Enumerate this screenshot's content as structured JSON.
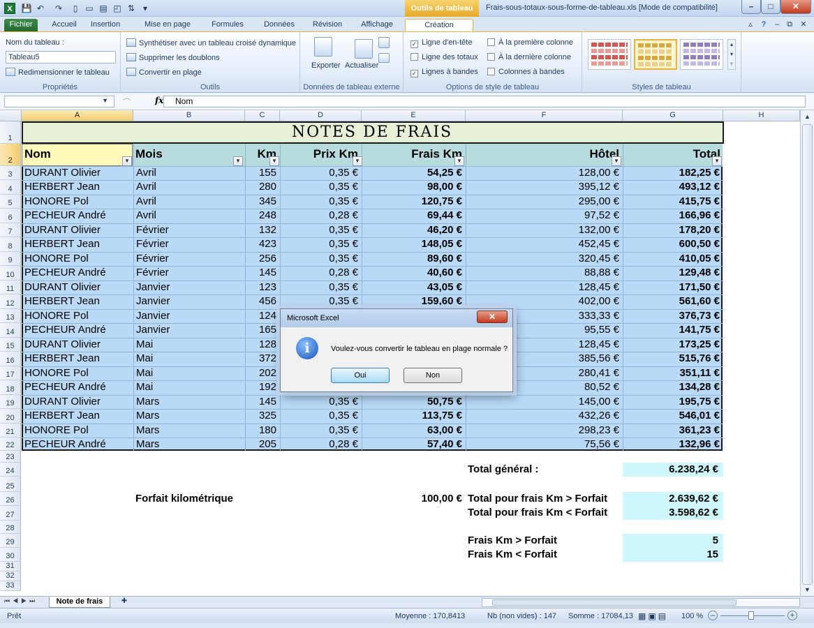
{
  "window": {
    "title": "Frais-sous-totaux-sous-forme-de-tableau.xls  [Mode de compatibilité]",
    "contextual_tab": "Outils de tableau",
    "min": "–",
    "max": "□",
    "close": "✕"
  },
  "tabs": [
    "Fichier",
    "Accueil",
    "Insertion",
    "Mise en page",
    "Formules",
    "Données",
    "Révision",
    "Affichage",
    "Création"
  ],
  "ribbon": {
    "proprietes": {
      "name_label": "Nom du tableau :",
      "name_value": "Tableau5",
      "resize": "Redimensionner le tableau",
      "group": "Propriétés"
    },
    "outils": {
      "pivot": "Synthétiser avec un tableau croisé dynamique",
      "dedupe": "Supprimer les doublons",
      "convert": "Convertir en plage",
      "group": "Outils"
    },
    "externe": {
      "export": "Exporter",
      "refresh": "Actualiser",
      "group": "Données de tableau externe"
    },
    "options": {
      "header_row": "Ligne d'en-tête",
      "total_row": "Ligne des totaux",
      "banded_rows": "Lignes à bandes",
      "first_col": "À la première colonne",
      "last_col": "À la dernière colonne",
      "banded_cols": "Colonnes à bandes",
      "group": "Options de style de tableau",
      "checks": {
        "header_row": "✓",
        "total_row": "",
        "banded_rows": "✓",
        "first_col": "",
        "last_col": "",
        "banded_cols": ""
      }
    },
    "styles": {
      "group": "Styles de tableau",
      "colors": [
        "#d9534f",
        "#e7b84a",
        "#8e7cc3"
      ]
    }
  },
  "formula_bar": {
    "fx": "fx",
    "value": "Nom"
  },
  "columns": [
    "A",
    "B",
    "C",
    "D",
    "E",
    "F",
    "G",
    "H"
  ],
  "sheet_title": "NOTES DE FRAIS",
  "headers": {
    "nom": "Nom",
    "mois": "Mois",
    "km": "Km",
    "prix": "Prix Km",
    "frais": "Frais Km",
    "hotel": "Hôtel",
    "total": "Total"
  },
  "rows": [
    [
      "DURANT Olivier",
      "Avril",
      "155",
      "0,35 €",
      "54,25 €",
      "128,00 €",
      "182,25 €"
    ],
    [
      "HERBERT Jean",
      "Avril",
      "280",
      "0,35 €",
      "98,00 €",
      "395,12 €",
      "493,12 €"
    ],
    [
      "HONORE Pol",
      "Avril",
      "345",
      "0,35 €",
      "120,75 €",
      "295,00 €",
      "415,75 €"
    ],
    [
      "PECHEUR André",
      "Avril",
      "248",
      "0,28 €",
      "69,44 €",
      "97,52 €",
      "166,96 €"
    ],
    [
      "DURANT Olivier",
      "Février",
      "132",
      "0,35 €",
      "46,20 €",
      "132,00 €",
      "178,20 €"
    ],
    [
      "HERBERT Jean",
      "Février",
      "423",
      "0,35 €",
      "148,05 €",
      "452,45 €",
      "600,50 €"
    ],
    [
      "HONORE Pol",
      "Février",
      "256",
      "0,35 €",
      "89,60 €",
      "320,45 €",
      "410,05 €"
    ],
    [
      "PECHEUR André",
      "Février",
      "145",
      "0,28 €",
      "40,60 €",
      "88,88 €",
      "129,48 €"
    ],
    [
      "DURANT Olivier",
      "Janvier",
      "123",
      "0,35 €",
      "43,05 €",
      "128,45 €",
      "171,50 €"
    ],
    [
      "HERBERT Jean",
      "Janvier",
      "456",
      "0,35 €",
      "159,60 €",
      "402,00 €",
      "561,60 €"
    ],
    [
      "HONORE Pol",
      "Janvier",
      "124",
      "",
      "",
      "333,33 €",
      "376,73 €"
    ],
    [
      "PECHEUR André",
      "Janvier",
      "165",
      "",
      "",
      "95,55 €",
      "141,75 €"
    ],
    [
      "DURANT Olivier",
      "Mai",
      "128",
      "",
      "",
      "128,45 €",
      "173,25 €"
    ],
    [
      "HERBERT Jean",
      "Mai",
      "372",
      "",
      "",
      "385,56 €",
      "515,76 €"
    ],
    [
      "HONORE Pol",
      "Mai",
      "202",
      "",
      "",
      "280,41 €",
      "351,11 €"
    ],
    [
      "PECHEUR André",
      "Mai",
      "192",
      "",
      "",
      "80,52 €",
      "134,28 €"
    ],
    [
      "DURANT Olivier",
      "Mars",
      "145",
      "0,35 €",
      "50,75 €",
      "145,00 €",
      "195,75 €"
    ],
    [
      "HERBERT Jean",
      "Mars",
      "325",
      "0,35 €",
      "113,75 €",
      "432,26 €",
      "546,01 €"
    ],
    [
      "HONORE Pol",
      "Mars",
      "180",
      "0,35 €",
      "63,00 €",
      "298,23 €",
      "361,23 €"
    ],
    [
      "PECHEUR André",
      "Mars",
      "205",
      "0,28 €",
      "57,40 €",
      "75,56 €",
      "132,96 €"
    ]
  ],
  "row_numbers": [
    "1",
    "2",
    "3",
    "4",
    "5",
    "6",
    "7",
    "8",
    "9",
    "10",
    "11",
    "12",
    "13",
    "14",
    "15",
    "16",
    "17",
    "18",
    "19",
    "20",
    "21",
    "22",
    "23",
    "24",
    "25",
    "26",
    "27",
    "28",
    "29",
    "30",
    "31",
    "32",
    "33"
  ],
  "summary": {
    "total_general_label": "Total général :",
    "total_general": "6.238,24 €",
    "forfait_label": "Forfait kilométrique",
    "forfait_value": "100,00 €",
    "sup_label": "Total pour frais Km > Forfait",
    "sup_value": "2.639,62 €",
    "inf_label": "Total pour frais Km < Forfait",
    "inf_value": "3.598,62 €",
    "count_sup_label": "Frais Km > Forfait",
    "count_sup": "5",
    "count_inf_label": "Frais Km < Forfait",
    "count_inf": "15"
  },
  "dialog": {
    "title": "Microsoft Excel",
    "icon": "i",
    "message": "Voulez-vous convertir le tableau en plage normale ?",
    "yes": "Oui",
    "no": "Non",
    "close": "✕"
  },
  "sheet_tab": "Note de frais",
  "status": {
    "ready": "Prêt",
    "average": "Moyenne : 170,8413",
    "count": "Nb (non vides) : 147",
    "sum": "Somme : 17084,13",
    "zoom": "100 %"
  }
}
